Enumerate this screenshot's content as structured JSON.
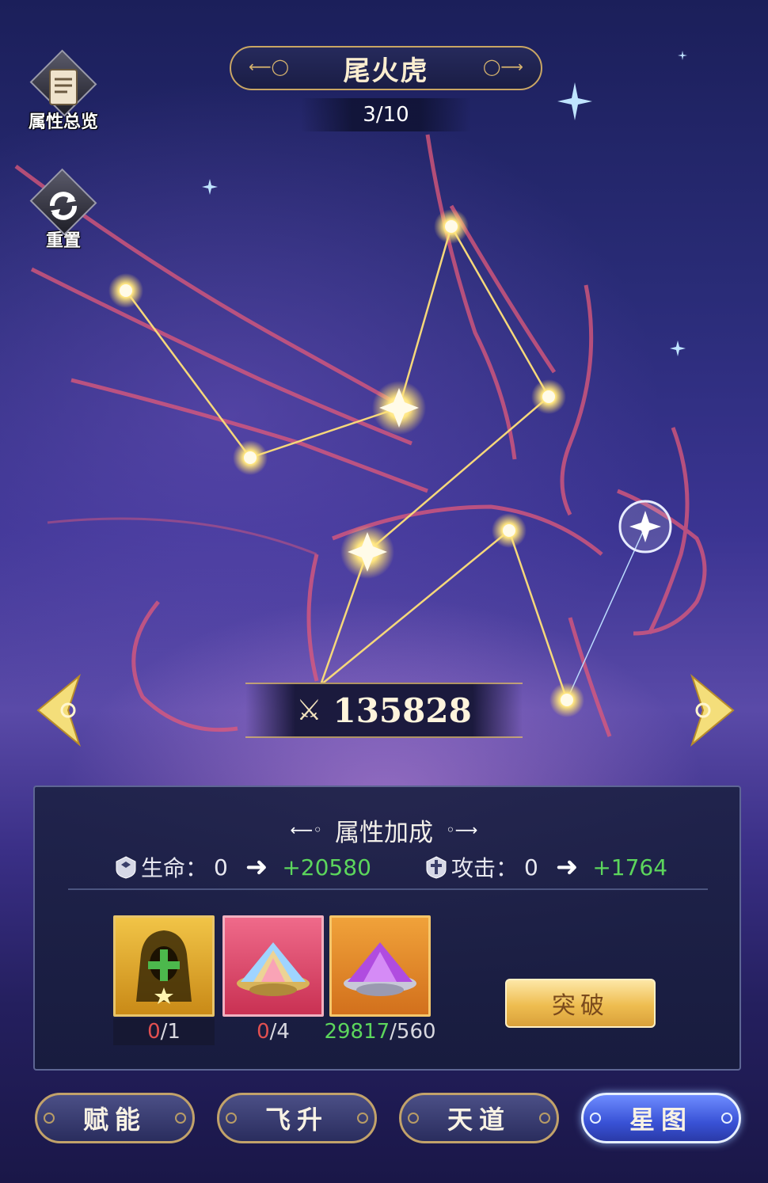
{
  "header": {
    "title": "尾火虎",
    "progress": "3/10"
  },
  "side_buttons": {
    "overview_label": "属性总览",
    "reset_label": "重置"
  },
  "power": {
    "value": "135828"
  },
  "panel": {
    "title": "属性加成",
    "stats": [
      {
        "name": "生命：",
        "current": "0",
        "bonus": "+20580"
      },
      {
        "name": "攻击：",
        "current": "0",
        "bonus": "+1764"
      }
    ],
    "materials": [
      {
        "icon": "hooded-hero-icon",
        "owned": "0",
        "required": "/1",
        "owned_status": "insufficient"
      },
      {
        "icon": "rainbow-crystal-icon",
        "owned": "0",
        "required": "/4",
        "owned_status": "insufficient"
      },
      {
        "icon": "purple-crystal-icon",
        "owned": "29817",
        "required": "/560",
        "owned_status": "sufficient"
      }
    ],
    "break_button": "突破"
  },
  "tabs": [
    {
      "label": "赋能",
      "active": false
    },
    {
      "label": "飞升",
      "active": false
    },
    {
      "label": "天道",
      "active": false
    },
    {
      "label": "星图",
      "active": true
    }
  ],
  "colors": {
    "insufficient": "#e25050",
    "sufficient": "#5cd65c",
    "gold_border": "#c9a664"
  }
}
